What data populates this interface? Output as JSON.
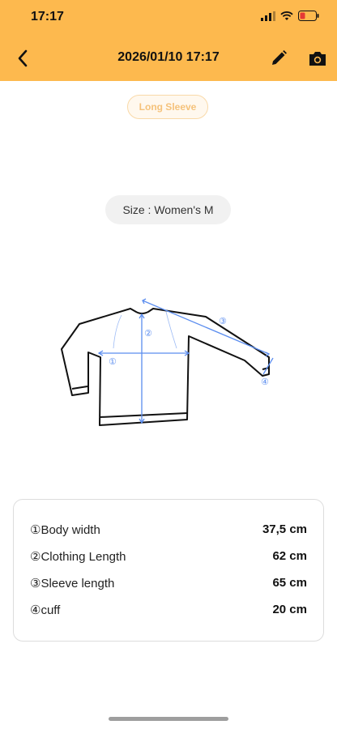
{
  "status_bar": {
    "time": "17:17"
  },
  "header": {
    "title": "2026/01/10 17:17"
  },
  "category_chip": "Long Sleeve",
  "size_label": "Size : Women's M",
  "diagram_markers": [
    "①",
    "②",
    "③",
    "④"
  ],
  "measurements": [
    {
      "label": "①Body width",
      "value": "37,5 cm"
    },
    {
      "label": "②Clothing Length",
      "value": "62 cm"
    },
    {
      "label": "③Sleeve length",
      "value": "65 cm"
    },
    {
      "label": "④cuff",
      "value": "20 cm"
    }
  ],
  "colors": {
    "header_bg": "#FDB94E",
    "accent_blue": "#5B8DEF",
    "chip_text": "#F5C27B"
  },
  "icons": {
    "back": "chevron-left-icon",
    "edit": "pencil-icon",
    "camera": "camera-icon"
  }
}
